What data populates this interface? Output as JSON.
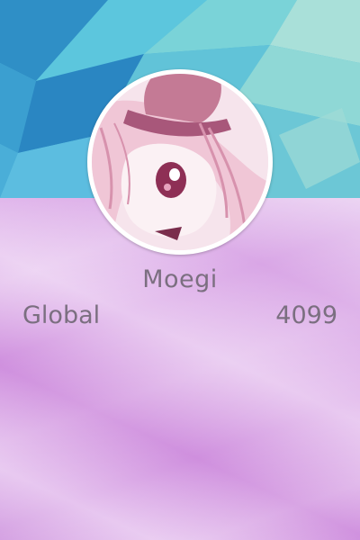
{
  "profile": {
    "username": "Moegi",
    "rank_label": "Global",
    "rank_value": "4099"
  },
  "colors": {
    "banner_base": "#4bb3d6",
    "panel_accent": "#d9a6e6",
    "text": "#7b6f80",
    "avatar_border": "#ffffff"
  },
  "icons": {
    "avatar": "anime-avatar-image",
    "banner": "geometric-banner-image"
  }
}
